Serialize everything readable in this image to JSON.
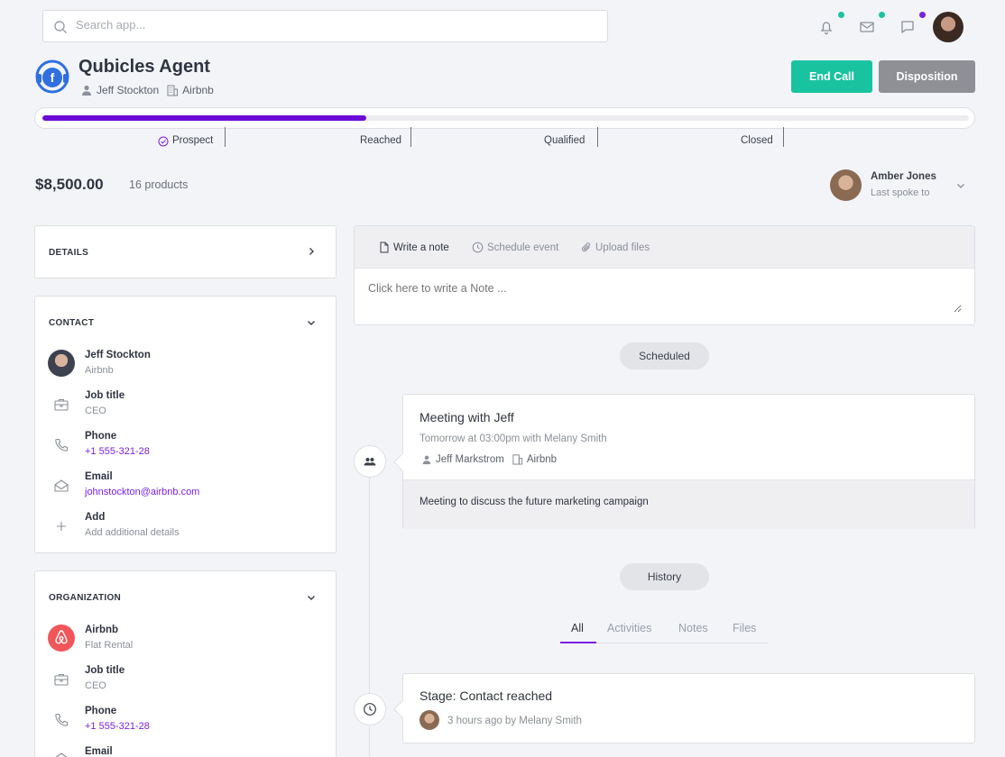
{
  "search": {
    "placeholder": "Search app..."
  },
  "topbar": {
    "icons": [
      "bell-icon",
      "mail-icon",
      "chat-icon"
    ],
    "dot_colors": [
      "#19c3a0",
      "#19c3a0",
      "#7a1fe0"
    ]
  },
  "header": {
    "title": "Qubicles Agent",
    "contact": "Jeff Stockton",
    "company": "Airbnb",
    "end_call": "End Call",
    "disposition": "Disposition"
  },
  "pipeline": {
    "progress": 0.35,
    "stages": [
      "Prospect",
      "Reached",
      "Qualified",
      "Closed"
    ]
  },
  "deal": {
    "amount": "$8,500.00",
    "products": "16 products",
    "owner_name": "Amber Jones",
    "owner_sub": "Last spoke to"
  },
  "details": {
    "title": "DETAILS"
  },
  "contact": {
    "title": "CONTACT",
    "name": "Jeff Stockton",
    "company": "Airbnb",
    "job_label": "Job title",
    "job_value": "CEO",
    "phone_label": "Phone",
    "phone_value": "+1 555-321-28",
    "email_label": "Email",
    "email_value": "johnstockton@airbnb.com",
    "add_label": "Add",
    "add_value": "Add additional details"
  },
  "organization": {
    "title": "ORGANIZATION",
    "name": "Airbnb",
    "type": "Flat Rental",
    "job_label": "Job title",
    "job_value": "CEO",
    "phone_label": "Phone",
    "phone_value": "+1 555-321-28",
    "email_label": "Email"
  },
  "note": {
    "tabs": [
      "Write a note",
      "Schedule event",
      "Upload files"
    ],
    "placeholder": "Click here to write a Note ..."
  },
  "scheduled": {
    "pill": "Scheduled",
    "title": "Meeting with Jeff",
    "when": "Tomorrow at 03:00pm with Melany Smith",
    "person": "Jeff Markstrom",
    "company": "Airbnb",
    "body": "Meeting to discuss the future marketing campaign"
  },
  "history": {
    "pill": "History",
    "tabs": [
      "All",
      "Activities",
      "Notes",
      "Files"
    ],
    "stage_title": "Stage: Contact reached",
    "stage_meta": "3 hours ago by Melany Smith"
  },
  "colors": {
    "accent": "#7a1fe0",
    "teal": "#19c3a0",
    "progress": "#6a0bd8"
  }
}
